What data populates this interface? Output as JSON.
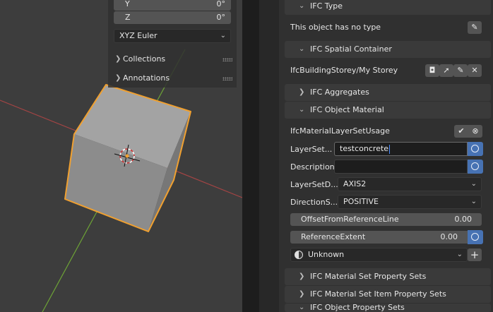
{
  "npanel": {
    "rot_y_label": "Y",
    "rot_y_value": "0°",
    "rot_z_label": "Z",
    "rot_z_value": "0°",
    "rotation_mode": "XYZ Euler",
    "collections": "Collections",
    "annotations": "Annotations"
  },
  "ifc": {
    "type_header": "IFC Type",
    "no_type_text": "This object has no type",
    "spatial_header": "IFC Spatial Container",
    "spatial_value": "IfcBuildingStorey/My Storey",
    "aggregates_header": "IFC Aggregates",
    "material_header": "IFC Object Material",
    "material_usage": "IfcMaterialLayerSetUsage",
    "layerset_label": "LayerSet...",
    "layerset_value": "testconcrete",
    "description_label": "Description:",
    "description_value": "",
    "layersetdir_label": "LayerSetD...",
    "layersetdir_value": "AXIS2",
    "directionsense_label": "DirectionS...",
    "directionsense_value": "POSITIVE",
    "offset_label": "OffsetFromReferenceLine",
    "offset_value": "0.00",
    "refextent_label": "ReferenceExtent",
    "refextent_value": "0.00",
    "material_value": "Unknown",
    "mat_set_psets": "IFC Material Set Property Sets",
    "mat_set_item_psets": "IFC Material Set Item Property Sets",
    "object_psets": "IFC Object Property Sets"
  },
  "colors": {
    "selection": "#f0a030",
    "accent": "#4772b3",
    "x_axis": "#c24a4a",
    "y_axis": "#7cb33c"
  }
}
